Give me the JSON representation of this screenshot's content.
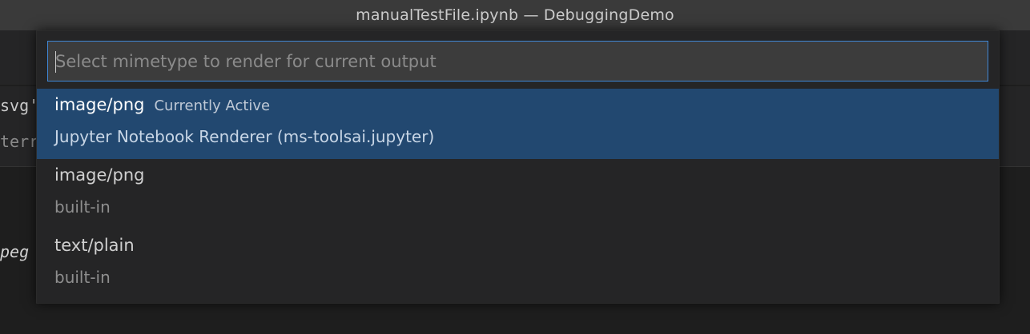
{
  "window": {
    "title": "manualTestFile.ipynb — DebuggingDemo"
  },
  "background": {
    "fragments": [
      "svg'}",
      "terru",
      "peg"
    ]
  },
  "quick_pick": {
    "placeholder": "Select mimetype to render for current output",
    "value": "",
    "items": [
      {
        "label": "image/png",
        "description": "Currently Active",
        "detail": "Jupyter Notebook Renderer (ms-toolsai.jupyter)",
        "selected": true
      },
      {
        "label": "image/png",
        "description": "",
        "detail": "built-in",
        "selected": false
      },
      {
        "label": "text/plain",
        "description": "",
        "detail": "built-in",
        "selected": false
      }
    ]
  },
  "colors": {
    "selection_bg": "#224870",
    "focus_border": "#3f87d6",
    "widget_bg": "#252526",
    "input_bg": "#3c3c3c"
  }
}
